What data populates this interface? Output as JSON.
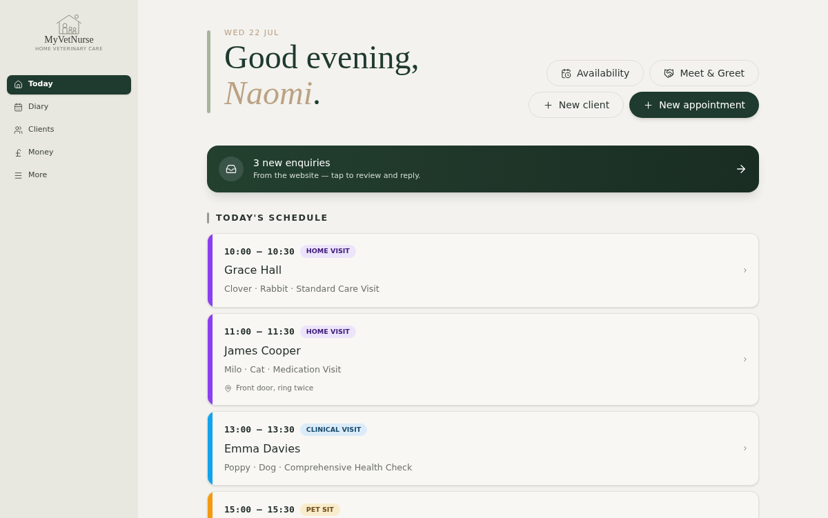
{
  "logo": {
    "name": "MyVetNurse",
    "tagline": "HOME VETERINARY CARE"
  },
  "sidebar": {
    "items": [
      {
        "label": "Today",
        "selected": true
      },
      {
        "label": "Diary",
        "selected": false
      },
      {
        "label": "Clients",
        "selected": false
      },
      {
        "label": "Money",
        "selected": false
      },
      {
        "label": "More",
        "selected": false
      }
    ]
  },
  "header": {
    "date": "WED 22 JUL",
    "greeting": "Good evening,",
    "name": "Naomi",
    "punctuation": "."
  },
  "actions": [
    {
      "label": "Availability",
      "kind": "outline"
    },
    {
      "label": "Meet & Greet",
      "kind": "outline"
    },
    {
      "label": "New client",
      "kind": "outline"
    },
    {
      "label": "New appointment",
      "kind": "primary"
    }
  ],
  "banner": {
    "title": "3 new enquiries",
    "subtitle": "From the website — tap to review and reply."
  },
  "schedule": {
    "heading": "TODAY'S SCHEDULE",
    "appointments": [
      {
        "time": "10:00 – 10:30",
        "tag": "HOME VISIT",
        "kind": "home",
        "color": "#8b3ff0",
        "client": "Grace Hall",
        "details": "Clover · Rabbit · Standard Care Visit"
      },
      {
        "time": "11:00 – 11:30",
        "tag": "HOME VISIT",
        "kind": "home",
        "color": "#8b3ff0",
        "client": "James Cooper",
        "details": "Milo · Cat · Medication Visit",
        "note": "Front door, ring twice"
      },
      {
        "time": "13:00 – 13:30",
        "tag": "CLINICAL VISIT",
        "kind": "clinical",
        "color": "#12a3ec",
        "client": "Emma Davies",
        "details": "Poppy · Dog · Comprehensive Health Check"
      },
      {
        "time": "15:00 – 15:30",
        "tag": "PET SIT",
        "kind": "petsit",
        "color": "#f29a12"
      }
    ]
  }
}
